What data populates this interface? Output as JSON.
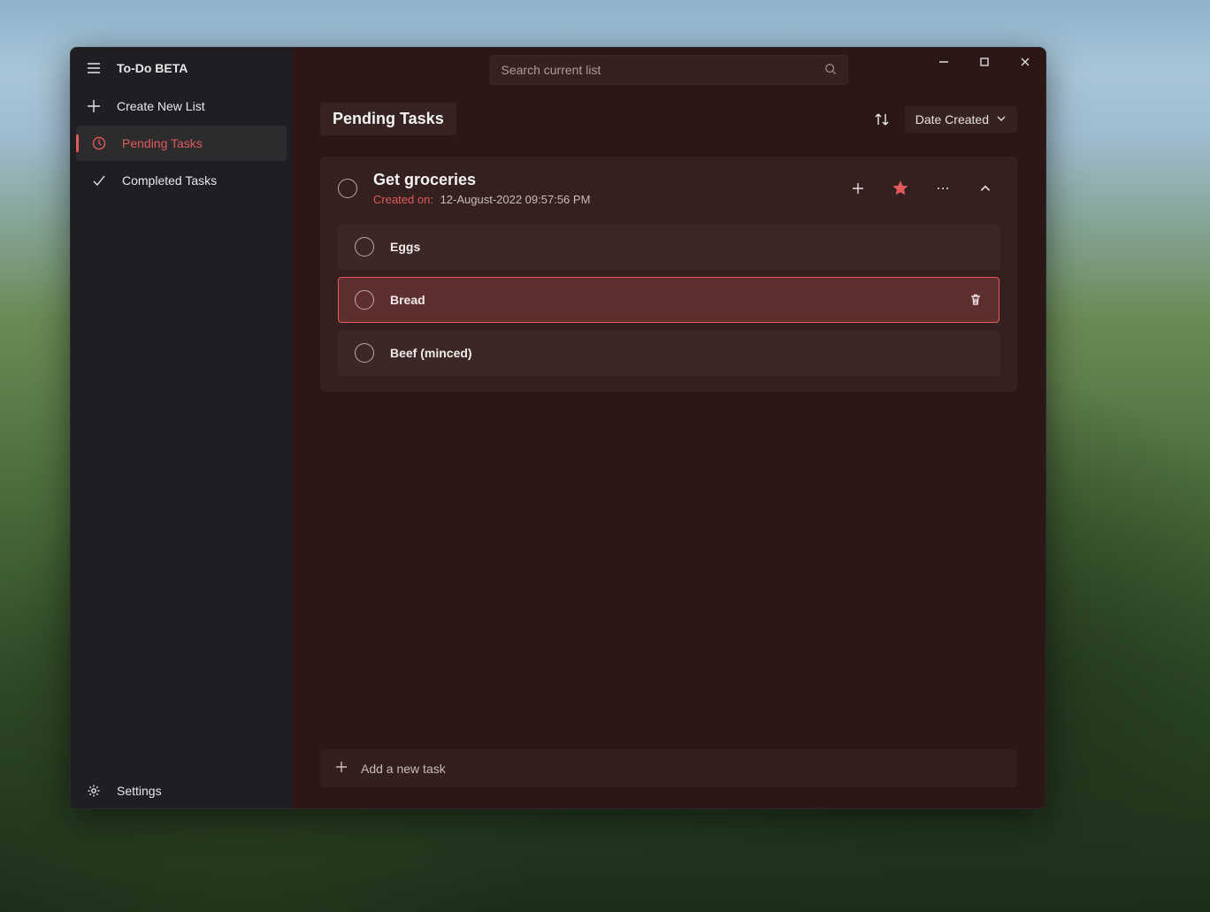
{
  "sidebar": {
    "app_title": "To-Do BETA",
    "create_list": "Create New List",
    "items": [
      {
        "label": "Pending Tasks",
        "icon": "clock",
        "active": true
      },
      {
        "label": "Completed Tasks",
        "icon": "check",
        "active": false
      }
    ],
    "settings": "Settings"
  },
  "search": {
    "placeholder": "Search current list"
  },
  "header": {
    "title": "Pending Tasks",
    "sort_label": "Date Created"
  },
  "task": {
    "title": "Get groceries",
    "created_label": "Created on:",
    "created_value": "12-August-2022 09:57:56 PM",
    "starred": true,
    "subtasks": [
      {
        "label": "Eggs",
        "selected": false
      },
      {
        "label": "Bread",
        "selected": true
      },
      {
        "label": "Beef (minced)",
        "selected": false
      }
    ]
  },
  "add_task_label": "Add a new task",
  "colors": {
    "accent": "#e05a5a",
    "main_bg": "#2c1616",
    "sidebar_bg": "#1f1f23"
  }
}
